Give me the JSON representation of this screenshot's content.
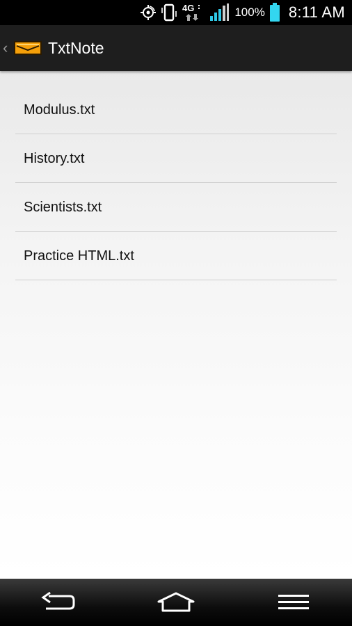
{
  "status_bar": {
    "icons": [
      "location-target-icon",
      "vibrate-icon",
      "4g-lte-data-icon",
      "signal-strength-icon",
      "battery-icon"
    ],
    "network_label": "4G",
    "battery_text": "100%",
    "time": "8:11 AM",
    "battery_color": "#33d6f0"
  },
  "action_bar": {
    "up_icon": "chevron-left-icon",
    "logo_icon": "envelope-logo-icon",
    "title": "TxtNote",
    "logo_color": "#f5a00a"
  },
  "files": [
    {
      "name": "Modulus.txt"
    },
    {
      "name": "History.txt"
    },
    {
      "name": "Scientists.txt"
    },
    {
      "name": "Practice HTML.txt"
    }
  ],
  "nav_bar": {
    "icons": [
      "back-icon",
      "home-icon",
      "menu-icon"
    ]
  }
}
